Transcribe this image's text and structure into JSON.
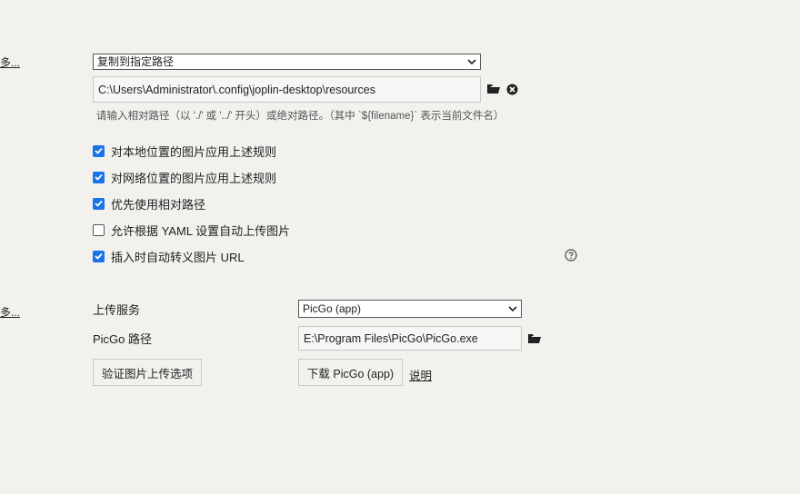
{
  "section1": {
    "more_link": "更多...",
    "copy_mode_select": {
      "selected": "复制到指定路径"
    },
    "path_input": {
      "value": "C:\\Users\\Administrator\\.config\\joplin-desktop\\resources"
    },
    "path_hint": "请输入相对路径（以 './' 或 '../' 开头）或绝对路径。（其中 `${filename}` 表示当前文件名）",
    "checkboxes": [
      {
        "label": "对本地位置的图片应用上述规则",
        "checked": true
      },
      {
        "label": "对网络位置的图片应用上述规则",
        "checked": true
      },
      {
        "label": "优先使用相对路径",
        "checked": true
      },
      {
        "label": "允许根据 YAML 设置自动上传图片",
        "checked": false
      },
      {
        "label": "插入时自动转义图片 URL",
        "checked": true
      }
    ]
  },
  "section2": {
    "more_link": "更多...",
    "upload_service_label": "上传服务",
    "upload_service_select": {
      "selected": "PicGo (app)"
    },
    "picgo_path_label": "PicGo 路径",
    "picgo_path_input": {
      "value": "E:\\Program Files\\PicGo\\PicGo.exe"
    },
    "verify_button": "验证图片上传选项",
    "download_button": "下载 PicGo (app)",
    "help_link": "说明"
  },
  "icons": {
    "folder": "folder-icon",
    "clear": "clear-circle-icon",
    "help": "help-circle-icon",
    "chevron": "chevron-down-icon"
  },
  "colors": {
    "accent": "#1a73e8",
    "background": "#f3f1ee"
  }
}
